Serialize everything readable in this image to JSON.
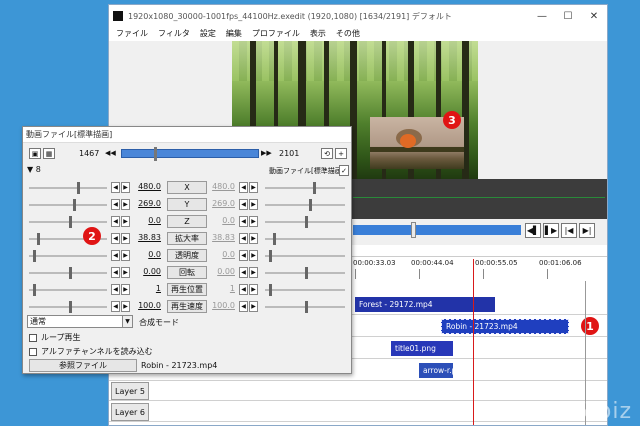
{
  "main_window": {
    "title": "1920x1080_30000-1001fps_44100Hz.exedit (1920,1080)  [1634/2191]  デフォルト",
    "controls": [
      "—",
      "☐",
      "✕"
    ],
    "menu": [
      "ファイル",
      "フィルタ",
      "設定",
      "編集",
      "プロファイル",
      "表示",
      "その他"
    ]
  },
  "badges": [
    "1",
    "2",
    "3"
  ],
  "seek_buttons": [
    "◀▌",
    "▌▶",
    "|◀",
    "▶|"
  ],
  "timeline": {
    "ruler": [
      "00:00:33.03",
      "00:00:44.04",
      "00:00:55.05",
      "00:01:06.06"
    ],
    "layers": [
      "Layer 5",
      "Layer 6"
    ],
    "clips": {
      "forest": "Forest - 29172.mp4",
      "robin": "Robin - 21723.mp4",
      "title": "title01.png",
      "arrow": "arrow-r.p"
    }
  },
  "properties": {
    "title": "動画ファイル[標準描画]",
    "frame_start": "1467",
    "frame_end": "2101",
    "object_label": "動画ファイル[標準描画]",
    "nav_left": "◀◀",
    "nav_right": "▶▶",
    "params": [
      {
        "name": "X",
        "left": "480.0",
        "right": "480.0"
      },
      {
        "name": "Y",
        "left": "269.0",
        "right": "269.0"
      },
      {
        "name": "Z",
        "left": "0.0",
        "right": "0.0"
      },
      {
        "name": "拡大率",
        "left": "38.83",
        "right": "38.83"
      },
      {
        "name": "透明度",
        "left": "0.0",
        "right": "0.0"
      },
      {
        "name": "回転",
        "left": "0.00",
        "right": "0.00"
      },
      {
        "name": "再生位置",
        "left": "1",
        "right": "1"
      },
      {
        "name": "再生速度",
        "left": "100.0",
        "right": "100.0"
      }
    ],
    "blend_mode": "通常",
    "blend_label": "合成モード",
    "loop_label": "ループ再生",
    "alpha_label": "アルファチャンネルを読み込む",
    "ref_button": "参照ファイル",
    "ref_file": "Robin - 21723.mp4"
  },
  "watermark": "k05.biz",
  "colors": {
    "badge": "#e01414",
    "clip": "#2233a8",
    "playhead": "#d81a1a",
    "desktop": "#3d96d6"
  }
}
